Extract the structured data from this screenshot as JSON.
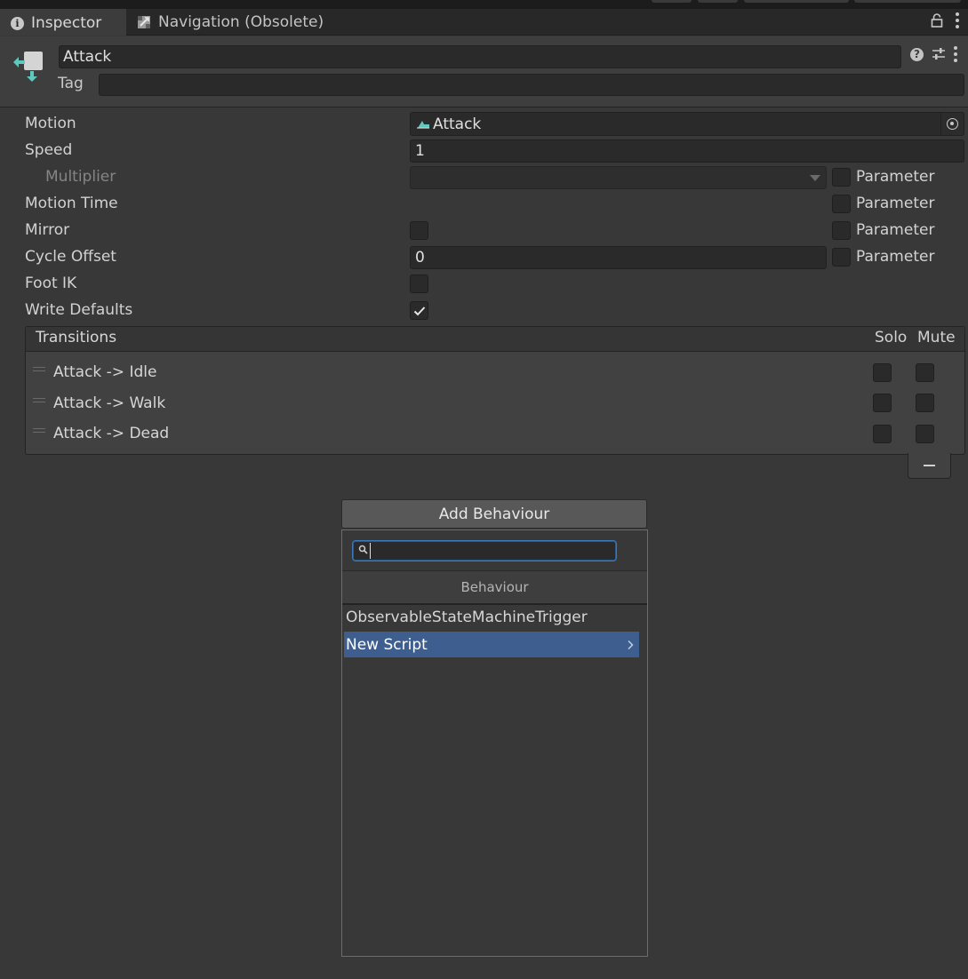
{
  "tabs": [
    {
      "label": "Inspector",
      "icon": "info-icon",
      "active": true
    },
    {
      "label": "Navigation (Obsolete)",
      "icon": "navigation-icon",
      "active": false
    }
  ],
  "header": {
    "name": "Attack",
    "tag_label": "Tag",
    "tag_value": ""
  },
  "properties": {
    "motion_label": "Motion",
    "motion_value": "Attack",
    "speed_label": "Speed",
    "speed_value": "1",
    "multiplier_label": "Multiplier",
    "multiplier_value": "",
    "motion_time_label": "Motion Time",
    "mirror_label": "Mirror",
    "mirror_checked": false,
    "cycle_offset_label": "Cycle Offset",
    "cycle_offset_value": "0",
    "foot_ik_label": "Foot IK",
    "foot_ik_checked": false,
    "write_defaults_label": "Write Defaults",
    "write_defaults_checked": true,
    "parameter_label": "Parameter"
  },
  "transitions": {
    "title": "Transitions",
    "solo_label": "Solo",
    "mute_label": "Mute",
    "rows": [
      {
        "label": "Attack -> Idle",
        "solo": false,
        "mute": false
      },
      {
        "label": "Attack -> Walk",
        "solo": false,
        "mute": false
      },
      {
        "label": "Attack -> Dead",
        "solo": false,
        "mute": false
      }
    ]
  },
  "behaviour": {
    "add_button": "Add Behaviour",
    "search_value": "",
    "category": "Behaviour",
    "items": [
      {
        "label": "ObservableStateMachineTrigger",
        "selected": false
      },
      {
        "label": "New Script",
        "selected": true
      }
    ]
  },
  "colors": {
    "background": "#383838",
    "selection": "#3d5e8f",
    "focus_border": "#3a79bb"
  }
}
